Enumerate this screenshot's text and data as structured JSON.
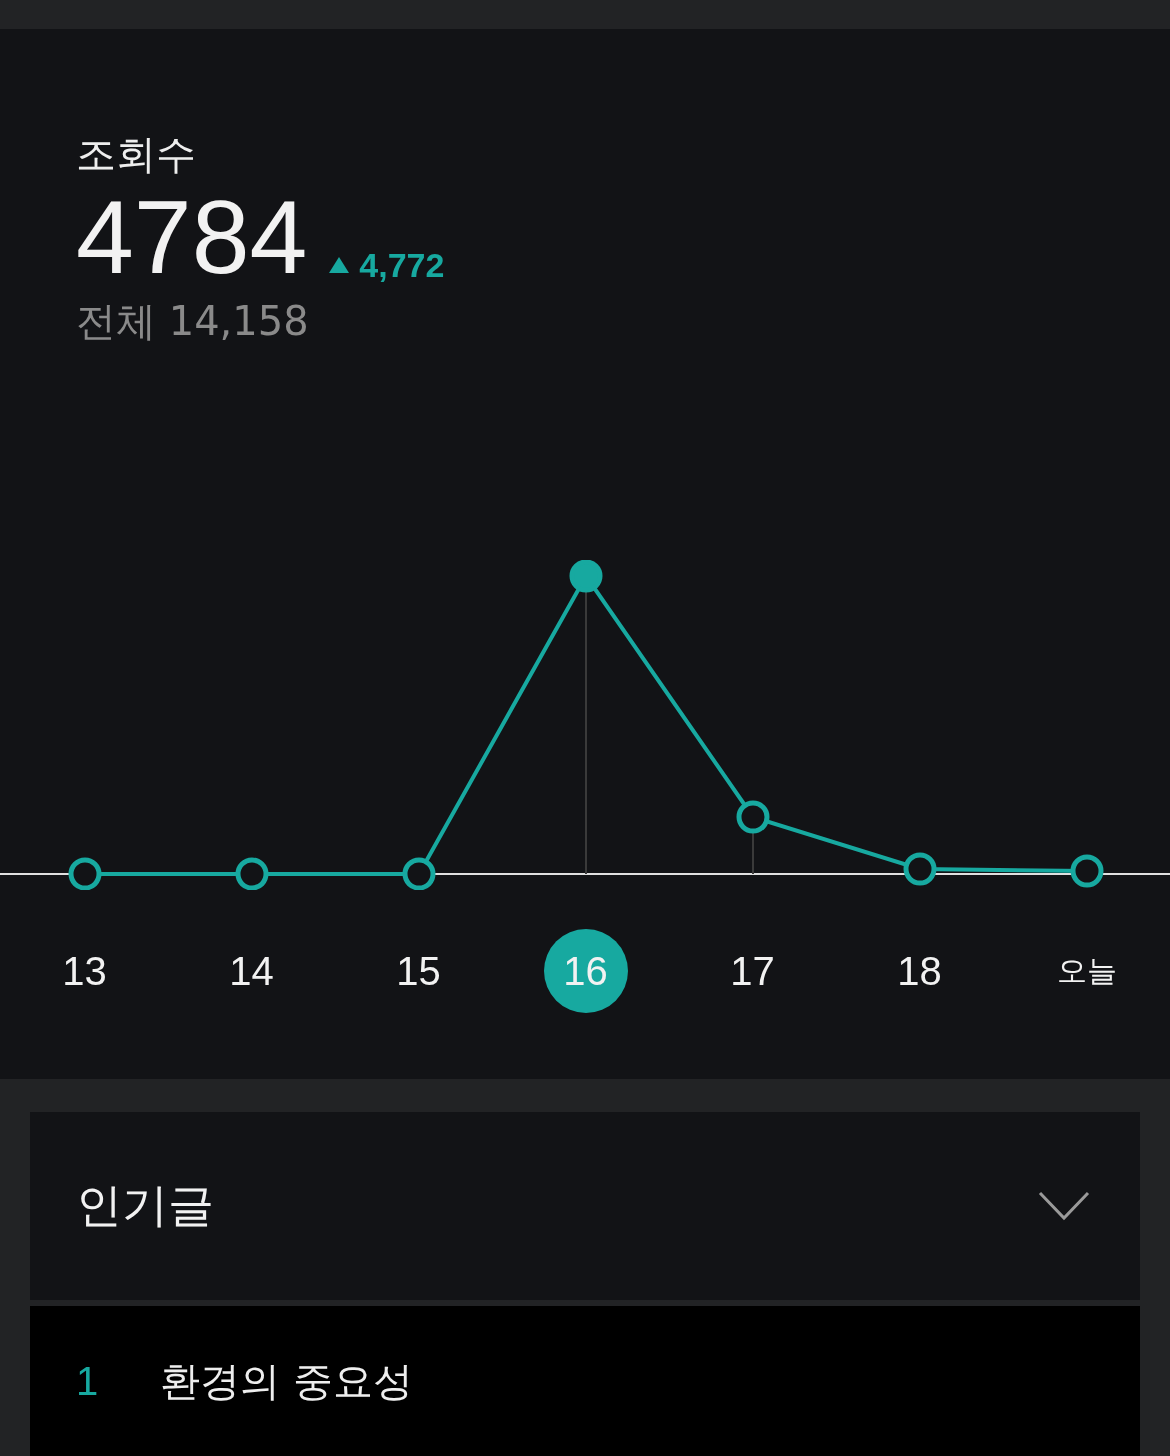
{
  "stats": {
    "label": "조회수",
    "value": "4784",
    "change": "4,772",
    "total": "전체 14,158"
  },
  "days": [
    {
      "label": "13",
      "selected": false
    },
    {
      "label": "14",
      "selected": false
    },
    {
      "label": "15",
      "selected": false
    },
    {
      "label": "16",
      "selected": true
    },
    {
      "label": "17",
      "selected": false
    },
    {
      "label": "18",
      "selected": false
    },
    {
      "label": "오늘",
      "selected": false
    }
  ],
  "popular": {
    "title": "인기글",
    "expanded": false,
    "items": [
      {
        "rank": "1",
        "title": "환경의 중요성"
      }
    ]
  }
}
